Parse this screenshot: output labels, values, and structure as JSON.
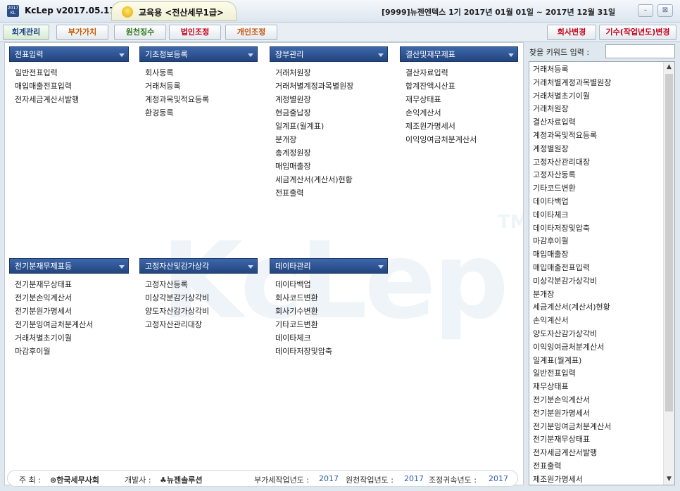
{
  "titlebar": {
    "logo_text": "2017 KL",
    "app_title": "KcLep v2017.05.17",
    "edu_label": "교육용 <전산세무1급>",
    "period": "[9999]뉴젠엔텍스 1기 2017년 01월 01일 ~ 2017년 12월 31일",
    "minimize_glyph": "–",
    "close_glyph": "⊠"
  },
  "menubar": {
    "tabs": [
      {
        "label": "회계관리",
        "color": "#1f3f8a"
      },
      {
        "label": "부가가치",
        "color": "#c45a00"
      },
      {
        "label": "원천징수",
        "color": "#2f7a1f"
      },
      {
        "label": "법인조정",
        "color": "#c4001a"
      },
      {
        "label": "개인조정",
        "color": "#c4500a"
      }
    ],
    "company_change": "회사변경",
    "period_change": "기수(작업년도)변경"
  },
  "watermark": "KcLep",
  "watermark_tm": "TM",
  "groups": {
    "voucher": {
      "title": "전표입력",
      "items": [
        "일반전표입력",
        "매입매출전표입력",
        "전자세금계산서발행"
      ]
    },
    "basic": {
      "title": "기초정보등록",
      "items": [
        "회사등록",
        "거래처등록",
        "계정과목및적요등록",
        "환경등록"
      ]
    },
    "ledger": {
      "title": "장부관리",
      "items": [
        "거래처원장",
        "거래처별계정과목별원장",
        "계정별원장",
        "현금출납장",
        "일계표(월계표)",
        "분개장",
        "총계정원장",
        "매입매출장",
        "세금계산서(계산서)현황",
        "전표출력"
      ]
    },
    "closing": {
      "title": "결산및재무제표",
      "items": [
        "결산자료입력",
        "합계잔액시산표",
        "재무상태표",
        "손익계산서",
        "제조원가명세서",
        "이익잉여금처분계산서"
      ]
    },
    "prior": {
      "title": "전기분재무제표등",
      "items": [
        "전기분재무상태표",
        "전기분손익계산서",
        "전기분원가명세서",
        "전기분잉여금처분계산서",
        "거래처별초기이월",
        "마감후이월"
      ]
    },
    "assets": {
      "title": "고정자산및감가상각",
      "items": [
        "고정자산등록",
        "미상각분감가상각비",
        "양도자산감가상각비",
        "고정자산관리대장"
      ]
    },
    "data": {
      "title": "데이타관리",
      "items": [
        "데이타백업",
        "회사코드변환",
        "회사기수변환",
        "기타코드변환",
        "데이타체크",
        "데이타저장및압축"
      ]
    }
  },
  "footer": {
    "host_label": "주 최 :",
    "host": "⊛한국세무사회",
    "dev_label": "개발사 :",
    "dev": "♣뉴젠솔루션",
    "vat_label": "부가세작업년도 :",
    "vat_year": "2017",
    "wh_label": "원천작업년도 :",
    "wh_year": "2017",
    "adj_label": "조정귀속년도 :",
    "adj_year": "2017"
  },
  "search": {
    "label": "찾을 키워드 입력 :",
    "value": ""
  },
  "keyword_list": [
    "거래처등록",
    "거래처별계정과목별원장",
    "거래처별초기이월",
    "거래처원장",
    "결산자료입력",
    "계정과목및적요등록",
    "계정별원장",
    "고정자산관리대장",
    "고정자산등록",
    "기타코드변환",
    "데이타백업",
    "데이타체크",
    "데이타저장및압축",
    "마감후이월",
    "매입매출장",
    "매입매출전표입력",
    "미상각분감가상각비",
    "분개장",
    "세금계산서(계산서)현황",
    "손익계산서",
    "양도자산감가상각비",
    "이익잉여금처분계산서",
    "일계표(월계표)",
    "일반전표입력",
    "재무상태표",
    "전기분손익계산서",
    "전기분원가명세서",
    "전기분잉여금처분계산서",
    "전기분재무상태표",
    "전자세금계산서발행",
    "전표출력",
    "제조원가명세서"
  ],
  "scrollbar": {
    "up": "▲",
    "down": "▼"
  }
}
